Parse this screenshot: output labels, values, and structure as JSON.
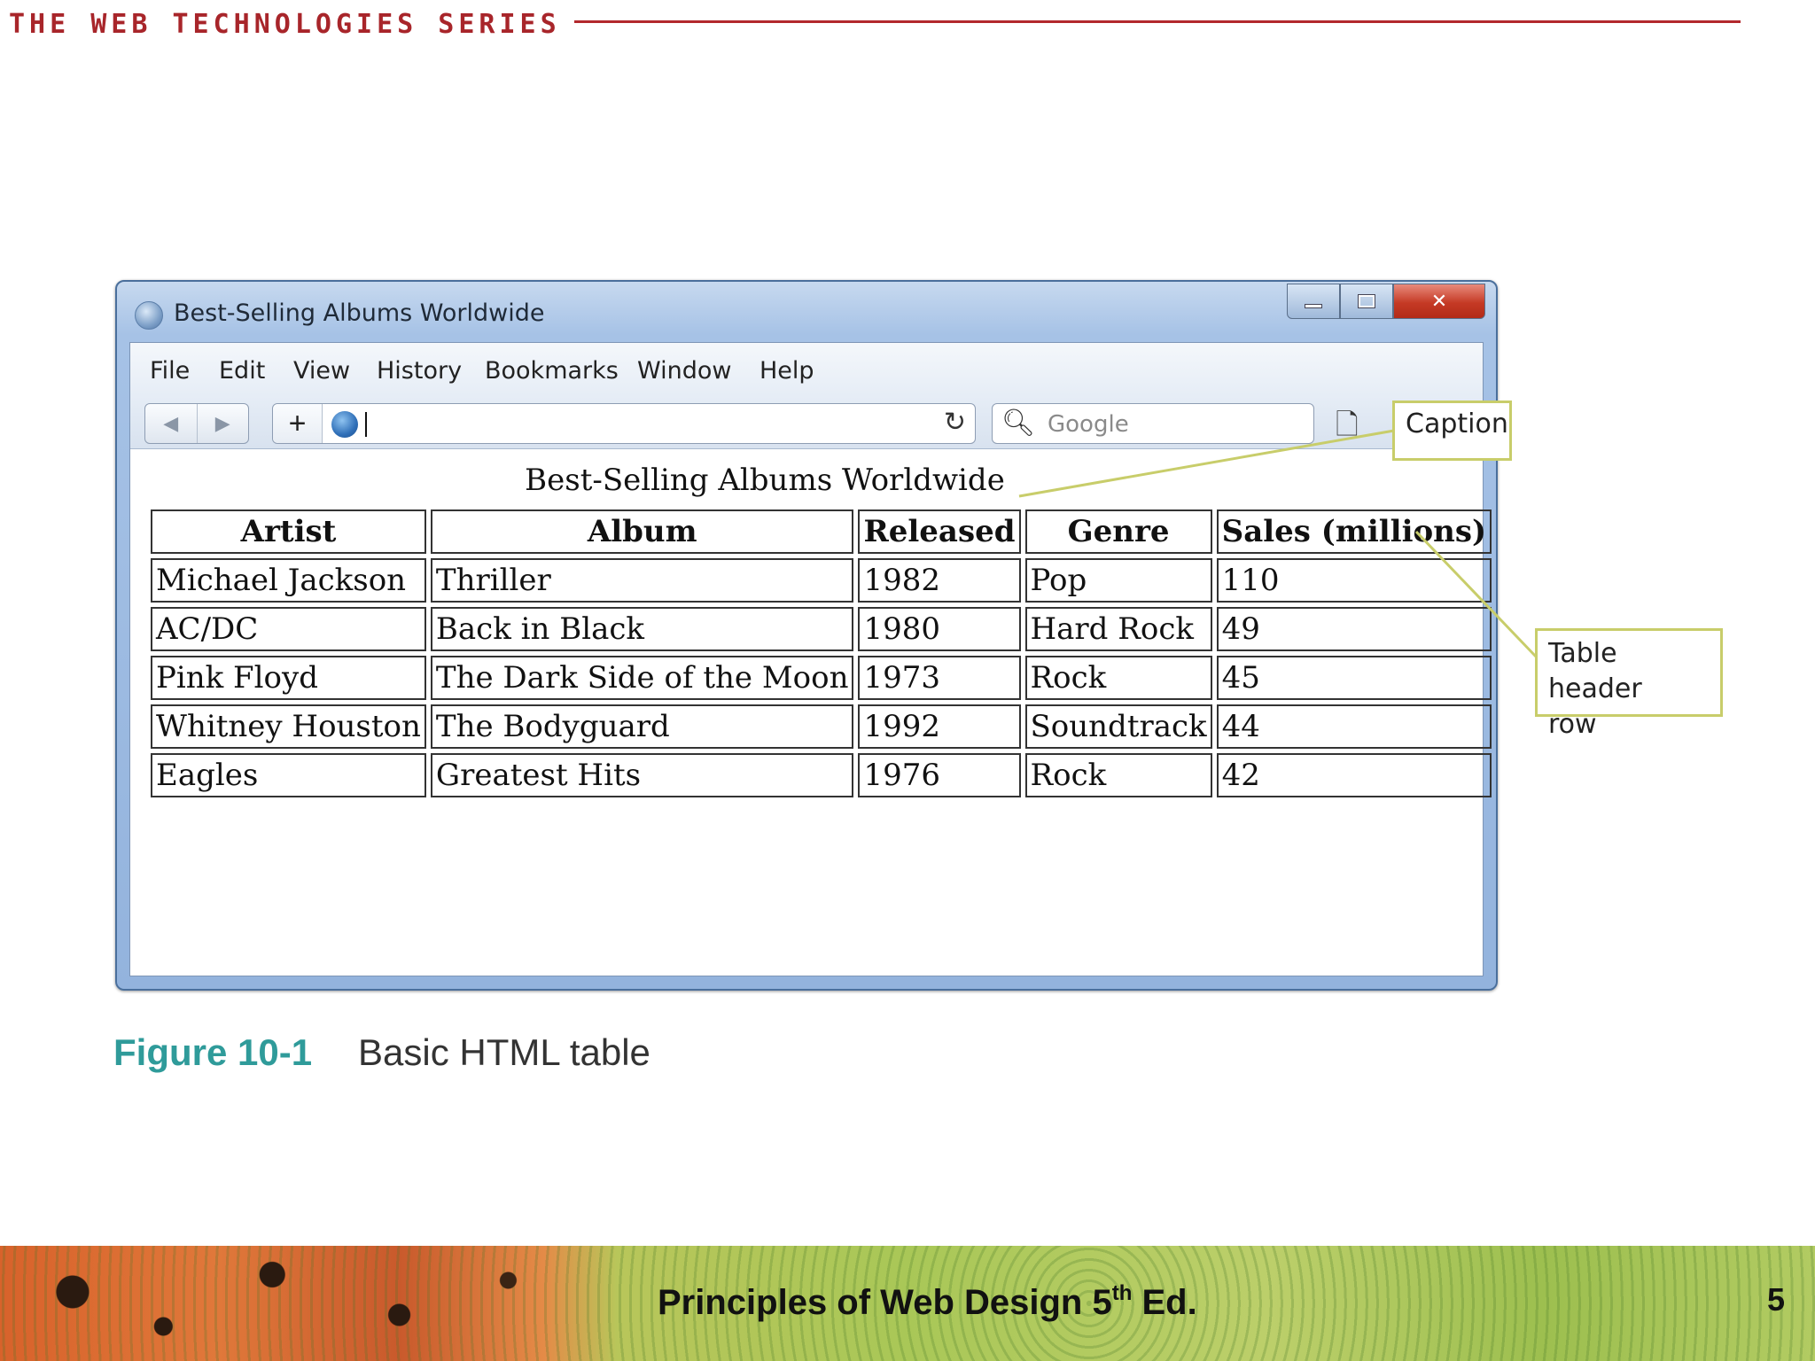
{
  "slide": {
    "series_title": "THE WEB TECHNOLOGIES SERIES",
    "figure_label": "Figure 10-1",
    "figure_text": "Basic HTML table",
    "footer_title_pre": "Principles of Web Design 5",
    "footer_title_sup": "th",
    "footer_title_post": " Ed.",
    "page_number": "5"
  },
  "window": {
    "title": "Best-Selling Albums Worldwide",
    "menu": [
      "File",
      "Edit",
      "View",
      "History",
      "Bookmarks",
      "Window",
      "Help"
    ],
    "url_value": "",
    "search_placeholder": "Google"
  },
  "page": {
    "caption": "Best-Selling Albums Worldwide",
    "table": {
      "headers": [
        "Artist",
        "Album",
        "Released",
        "Genre",
        "Sales (millions)"
      ],
      "rows": [
        [
          "Michael Jackson",
          "Thriller",
          "1982",
          "Pop",
          "110"
        ],
        [
          "AC/DC",
          "Back in Black",
          "1980",
          "Hard Rock",
          "49"
        ],
        [
          "Pink Floyd",
          "The Dark Side of the Moon",
          "1973",
          "Rock",
          "45"
        ],
        [
          "Whitney Houston",
          "The Bodyguard",
          "1992",
          "Soundtrack",
          "44"
        ],
        [
          "Eagles",
          "Greatest Hits",
          "1976",
          "Rock",
          "42"
        ]
      ]
    }
  },
  "callouts": {
    "caption": "Caption",
    "header_line1": "Table header",
    "header_line2": "row"
  },
  "colors": {
    "series_red": "#a8252a",
    "figure_teal": "#2f9b9a",
    "callout_border": "#c8cd6a"
  },
  "icons": [
    "app-icon",
    "minimize-icon",
    "maximize-icon",
    "close-icon",
    "back-arrow-icon",
    "forward-arrow-icon",
    "plus-icon",
    "globe-icon",
    "reload-icon",
    "search-icon",
    "page-icon"
  ]
}
